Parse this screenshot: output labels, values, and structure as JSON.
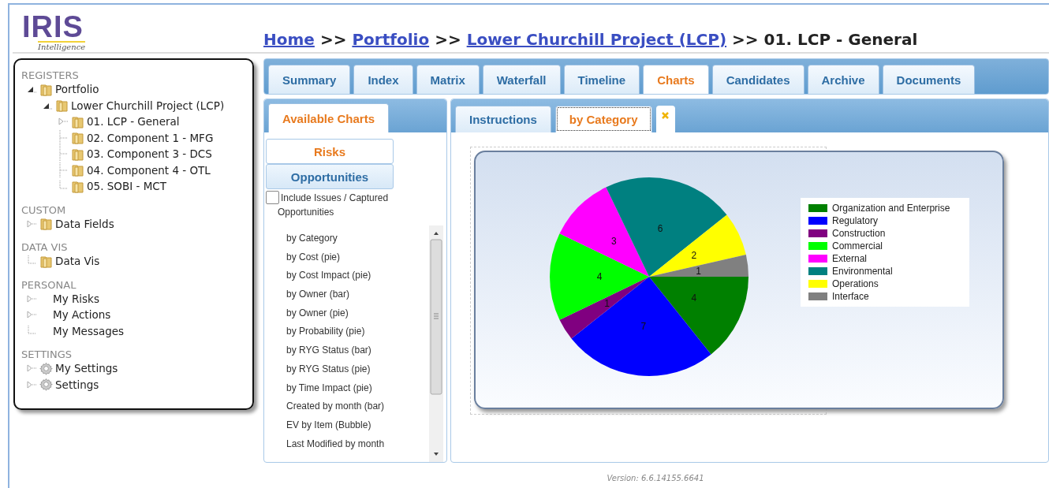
{
  "logo": {
    "title": "IRIS",
    "subtitle": "Intelligence"
  },
  "breadcrumb": [
    {
      "kind": "link",
      "text": "Home"
    },
    {
      "kind": "separator",
      "text": ">>"
    },
    {
      "kind": "link",
      "text": "Portfolio"
    },
    {
      "kind": "separator",
      "text": ">>"
    },
    {
      "kind": "link",
      "text": "Lower Churchill Project (LCP)"
    },
    {
      "kind": "separator",
      "text": ">>"
    },
    {
      "kind": "current",
      "text": "01. LCP - General"
    }
  ],
  "sidebar": {
    "sections": [
      {
        "title": "REGISTERS",
        "items": [
          {
            "label": "Portfolio",
            "kind": "folder",
            "expanded": true,
            "children": [
              {
                "label": "Lower Churchill Project (LCP)",
                "kind": "folder",
                "expanded": true,
                "children": [
                  {
                    "label": "01. LCP - General",
                    "kind": "folder",
                    "expanded": false
                  },
                  {
                    "label": "02. Component 1 - MFG",
                    "kind": "folder"
                  },
                  {
                    "label": "03. Component 3 - DCS",
                    "kind": "folder"
                  },
                  {
                    "label": "04. Component 4 - OTL",
                    "kind": "folder"
                  },
                  {
                    "label": "05. SOBI - MCT",
                    "kind": "folder"
                  }
                ]
              }
            ]
          }
        ]
      },
      {
        "title": "CUSTOM",
        "items": [
          {
            "label": "Data Fields",
            "kind": "folder",
            "expanded": false
          }
        ]
      },
      {
        "title": "DATA VIS",
        "items": [
          {
            "label": "Data Vis",
            "kind": "folder"
          }
        ]
      },
      {
        "title": "PERSONAL",
        "items": [
          {
            "label": "My Risks",
            "kind": "plain",
            "expanded": false
          },
          {
            "label": "My Actions",
            "kind": "plain",
            "expanded": false
          },
          {
            "label": "My Messages",
            "kind": "plain"
          }
        ]
      },
      {
        "title": "SETTINGS",
        "items": [
          {
            "label": "My Settings",
            "kind": "gear",
            "expanded": false
          },
          {
            "label": "Settings",
            "kind": "gear",
            "expanded": false
          }
        ]
      }
    ]
  },
  "tabs": [
    {
      "label": "Summary",
      "selected": false
    },
    {
      "label": "Index",
      "selected": false
    },
    {
      "label": "Matrix",
      "selected": false
    },
    {
      "label": "Waterfall",
      "selected": false
    },
    {
      "label": "Timeline",
      "selected": false
    },
    {
      "label": "Charts",
      "selected": true
    },
    {
      "label": "Candidates",
      "selected": false
    },
    {
      "label": "Archive",
      "selected": false
    },
    {
      "label": "Documents",
      "selected": false
    }
  ],
  "charts_panel": {
    "tab": {
      "label": "Available Charts",
      "selected": true
    },
    "types": [
      {
        "label": "Risks",
        "selected": true
      },
      {
        "label": "Opportunities",
        "selected": false
      }
    ],
    "include_issues": {
      "label": "Include Issues / Captured Opportunities",
      "checked": false
    },
    "items": [
      "by Category",
      "by Cost (pie)",
      "by Cost Impact (pie)",
      "by Owner (bar)",
      "by Owner (pie)",
      "by Probability (pie)",
      "by RYG Status (bar)",
      "by RYG Status (pie)",
      "by Time Impact (pie)",
      "Created by month (bar)",
      "EV by Item (Bubble)",
      "Last Modified by month"
    ]
  },
  "view_tabs": [
    {
      "label": "Instructions",
      "selected": false,
      "closable": false
    },
    {
      "label": "by Category",
      "selected": true,
      "closable": true
    }
  ],
  "chart": {
    "chart_data": {
      "type": "pie",
      "categories": [
        "Organization and Enterprise",
        "Regulatory",
        "Construction",
        "Commercial",
        "External",
        "Environmental",
        "Operations",
        "Interface"
      ],
      "values": [
        4,
        7,
        1,
        4,
        3,
        6,
        2,
        1
      ],
      "colors": [
        "#008000",
        "#0000ff",
        "#800080",
        "#00ff00",
        "#ff00ff",
        "#008080",
        "#ffff00",
        "#808080"
      ],
      "data_labels": true
    }
  },
  "version": "Version: 6.6.14155.6641"
}
